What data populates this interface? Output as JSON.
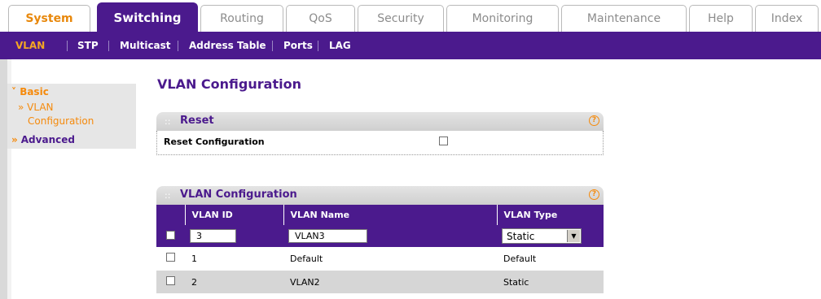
{
  "top_tabs": [
    {
      "label": "System"
    },
    {
      "label": "Switching"
    },
    {
      "label": "Routing"
    },
    {
      "label": "QoS"
    },
    {
      "label": "Security"
    },
    {
      "label": "Monitoring"
    },
    {
      "label": "Maintenance"
    },
    {
      "label": "Help"
    },
    {
      "label": "Index"
    }
  ],
  "sub_nav": [
    {
      "label": "VLAN"
    },
    {
      "label": "STP"
    },
    {
      "label": "Multicast"
    },
    {
      "label": "Address Table"
    },
    {
      "label": "Ports"
    },
    {
      "label": "LAG"
    }
  ],
  "left_nav": {
    "basic": "Basic",
    "basic_marker": "»",
    "vlan_config_marker": "»",
    "vlan_config_line1": "VLAN",
    "vlan_config_line2": "Configuration",
    "advanced": "Advanced",
    "advanced_marker": "»"
  },
  "page_title": "VLAN Configuration",
  "reset_section": {
    "title": "Reset",
    "help": "?",
    "row_label": "Reset Configuration"
  },
  "vlan_section": {
    "title": "VLAN Configuration",
    "help": "?",
    "columns": [
      "VLAN ID",
      "VLAN Name",
      "VLAN Type"
    ],
    "edit_row": {
      "vlan_id": "3",
      "vlan_name": "VLAN3",
      "vlan_type": "Static"
    },
    "rows": [
      {
        "vlan_id": "1",
        "vlan_name": "Default",
        "vlan_type": "Default"
      },
      {
        "vlan_id": "2",
        "vlan_name": "VLAN2",
        "vlan_type": "Static"
      }
    ]
  },
  "colors": {
    "brand_purple": "#4b1a8d",
    "accent_orange": "#f58a0c"
  }
}
